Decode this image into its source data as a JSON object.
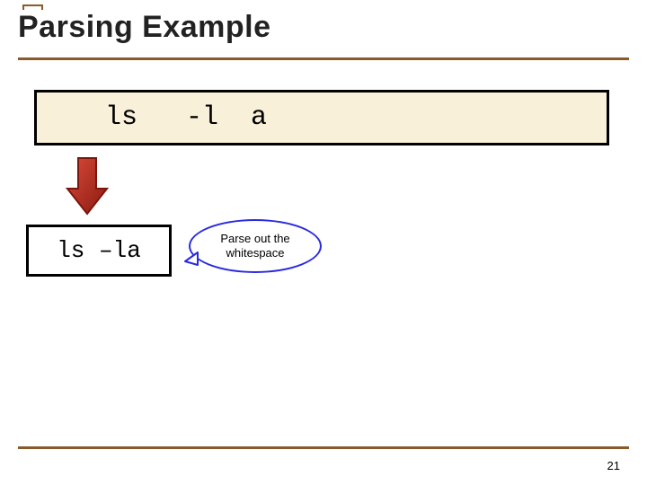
{
  "slide": {
    "title": "Parsing Example",
    "code_raw": "  ls   -l  a",
    "result": "ls –la",
    "callout": {
      "line1": "Parse out the",
      "line2": "whitespace"
    },
    "page_number": "21"
  }
}
